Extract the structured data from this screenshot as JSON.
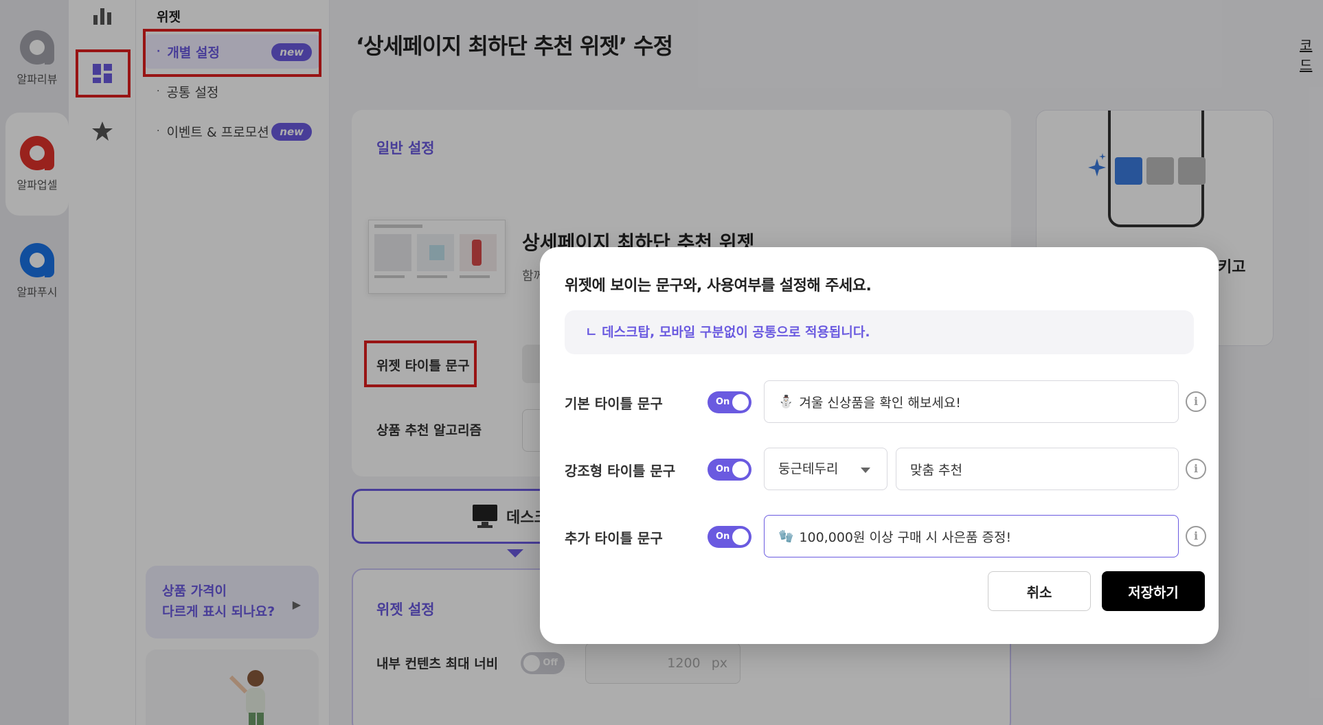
{
  "apps": [
    {
      "label": "알파리뷰",
      "color": "#9a9aa2"
    },
    {
      "label": "알파업셀",
      "color": "#e2332c"
    },
    {
      "label": "알파푸시",
      "color": "#1a73e8"
    }
  ],
  "subnav": {
    "title": "위젯",
    "items": [
      {
        "label": "개별 설정",
        "badge": "new"
      },
      {
        "label": "공통 설정"
      },
      {
        "label": "이벤트 & 프로모션",
        "badge": "new"
      }
    ],
    "promo": {
      "line1": "상품 가격이",
      "line2": "다르게 표시 되나요?"
    }
  },
  "page": {
    "title": "‘상세페이지 최하단 추천 위젯’ 수정",
    "top_link": "코드"
  },
  "general": {
    "section_title": "일반 설정",
    "widget_name": "상세페이지 최하단 추천 위젯",
    "widget_desc": "함께",
    "title_label": "위젯 타이틀 문구",
    "algo_label": "상품 추천 알고리즘"
  },
  "device_tab": {
    "label": "데스크"
  },
  "widget_settings": {
    "section_title": "위젯 설정",
    "max_width_label": "내부 컨텐츠 최대 너비",
    "toggle": "Off",
    "width_value": "1200",
    "width_unit": "px"
  },
  "right_card": {
    "text": "키고"
  },
  "modal": {
    "title": "위젯에 보이는 문구와, 사용여부를 설정해 주세요.",
    "notice": "ㄴ 데스크탑, 모바일 구분없이 공통으로 적용됩니다.",
    "rows": [
      {
        "label": "기본 타이틀 문구",
        "toggle": "On",
        "emoji": "⛄",
        "value": "겨울 신상품을 확인 해보세요!"
      },
      {
        "label": "강조형 타이틀 문구",
        "toggle": "On",
        "select": "둥근테두리",
        "value": "맞춤 추천"
      },
      {
        "label": "추가 타이틀 문구",
        "toggle": "On",
        "emoji": "🧤",
        "value": "100,000원 이상 구매 시  사은품 증정!"
      }
    ],
    "info_glyph": "i",
    "cancel": "취소",
    "save": "저장하기"
  }
}
